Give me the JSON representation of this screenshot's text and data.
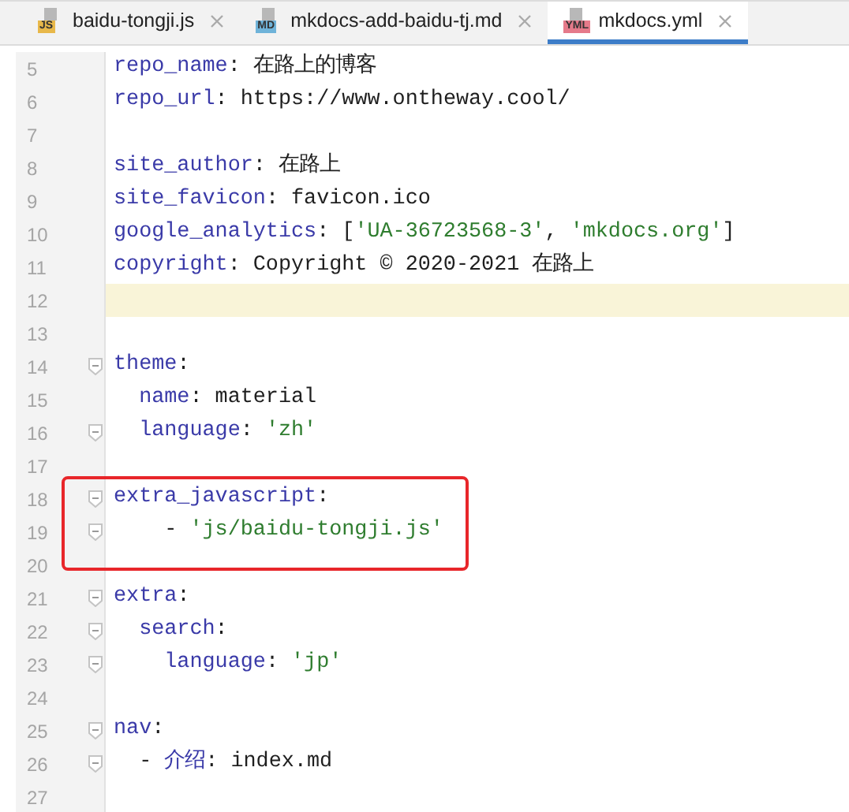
{
  "tabs": [
    {
      "label": "baidu-tongji.js",
      "icon_label": "JS",
      "color": "#e8b84a",
      "selected": false
    },
    {
      "label": "mkdocs-add-baidu-tj.md",
      "icon_label": "MD",
      "color": "#6fb3d9",
      "selected": false
    },
    {
      "label": "mkdocs.yml",
      "icon_label": "YML",
      "color": "#e57a8a",
      "selected": true
    }
  ],
  "lines": [
    {
      "number": "5",
      "fold": false,
      "current": false,
      "boxed": false,
      "tokens": [
        {
          "kind": "key",
          "text": "repo_name"
        },
        {
          "kind": "plain",
          "text": ": 在路上的博客"
        }
      ]
    },
    {
      "number": "6",
      "fold": false,
      "current": false,
      "boxed": false,
      "tokens": [
        {
          "kind": "key",
          "text": "repo_url"
        },
        {
          "kind": "plain",
          "text": ": https://www.ontheway.cool/"
        }
      ]
    },
    {
      "number": "7",
      "fold": false,
      "current": false,
      "boxed": false
    },
    {
      "number": "8",
      "fold": false,
      "current": false,
      "boxed": false,
      "tokens": [
        {
          "kind": "key",
          "text": "site_author"
        },
        {
          "kind": "plain",
          "text": ": 在路上"
        }
      ]
    },
    {
      "number": "9",
      "fold": false,
      "current": false,
      "boxed": false,
      "tokens": [
        {
          "kind": "key",
          "text": "site_favicon"
        },
        {
          "kind": "plain",
          "text": ": favicon.ico"
        }
      ]
    },
    {
      "number": "10",
      "fold": false,
      "current": false,
      "boxed": false,
      "tokens": [
        {
          "kind": "key",
          "text": "google_analytics"
        },
        {
          "kind": "plain",
          "text": ": ["
        },
        {
          "kind": "string",
          "text": "'UA-36723568-3'"
        },
        {
          "kind": "plain",
          "text": ", "
        },
        {
          "kind": "string",
          "text": "'mkdocs.org'"
        },
        {
          "kind": "plain",
          "text": "]"
        }
      ]
    },
    {
      "number": "11",
      "fold": false,
      "current": false,
      "boxed": false,
      "tokens": [
        {
          "kind": "key",
          "text": "copyright"
        },
        {
          "kind": "plain",
          "text": ": Copyright © 2020-2021 在路上"
        }
      ]
    },
    {
      "number": "12",
      "fold": false,
      "current": true,
      "boxed": false
    },
    {
      "number": "13",
      "fold": false,
      "current": false,
      "boxed": false
    },
    {
      "number": "14",
      "fold": true,
      "current": false,
      "boxed": false,
      "tokens": [
        {
          "kind": "key",
          "text": "theme"
        },
        {
          "kind": "plain",
          "text": ":"
        }
      ]
    },
    {
      "number": "15",
      "fold": false,
      "current": false,
      "boxed": false,
      "tokens": [
        {
          "kind": "key",
          "text": "  name"
        },
        {
          "kind": "plain",
          "text": ": material"
        }
      ]
    },
    {
      "number": "16",
      "fold": true,
      "current": false,
      "boxed": false,
      "tokens": [
        {
          "kind": "key",
          "text": "  language"
        },
        {
          "kind": "plain",
          "text": ": "
        },
        {
          "kind": "string",
          "text": "'zh'"
        }
      ]
    },
    {
      "number": "17",
      "fold": false,
      "current": false,
      "boxed": false
    },
    {
      "number": "18",
      "fold": true,
      "current": false,
      "boxed": true,
      "tokens": [
        {
          "kind": "key",
          "text": "extra_javascript"
        },
        {
          "kind": "plain",
          "text": ":"
        }
      ]
    },
    {
      "number": "19",
      "fold": true,
      "current": false,
      "boxed": true,
      "tokens": [
        {
          "kind": "plain",
          "text": "    - "
        },
        {
          "kind": "string",
          "text": "'js/baidu-tongji.js'"
        }
      ]
    },
    {
      "number": "20",
      "fold": false,
      "current": false,
      "boxed": false
    },
    {
      "number": "21",
      "fold": true,
      "current": false,
      "boxed": false,
      "tokens": [
        {
          "kind": "key",
          "text": "extra"
        },
        {
          "kind": "plain",
          "text": ":"
        }
      ]
    },
    {
      "number": "22",
      "fold": true,
      "current": false,
      "boxed": false,
      "tokens": [
        {
          "kind": "key",
          "text": "  search"
        },
        {
          "kind": "plain",
          "text": ":"
        }
      ]
    },
    {
      "number": "23",
      "fold": true,
      "current": false,
      "boxed": false,
      "tokens": [
        {
          "kind": "key",
          "text": "    language"
        },
        {
          "kind": "plain",
          "text": ": "
        },
        {
          "kind": "string",
          "text": "'jp'"
        }
      ]
    },
    {
      "number": "24",
      "fold": false,
      "current": false,
      "boxed": false
    },
    {
      "number": "25",
      "fold": true,
      "current": false,
      "boxed": false,
      "tokens": [
        {
          "kind": "key",
          "text": "nav"
        },
        {
          "kind": "plain",
          "text": ":"
        }
      ]
    },
    {
      "number": "26",
      "fold": true,
      "current": false,
      "boxed": false,
      "tokens": [
        {
          "kind": "plain",
          "text": "  - "
        },
        {
          "kind": "key",
          "text": "介绍"
        },
        {
          "kind": "plain",
          "text": ": index.md"
        }
      ]
    },
    {
      "number": "27",
      "fold": false,
      "current": false,
      "boxed": false
    }
  ]
}
